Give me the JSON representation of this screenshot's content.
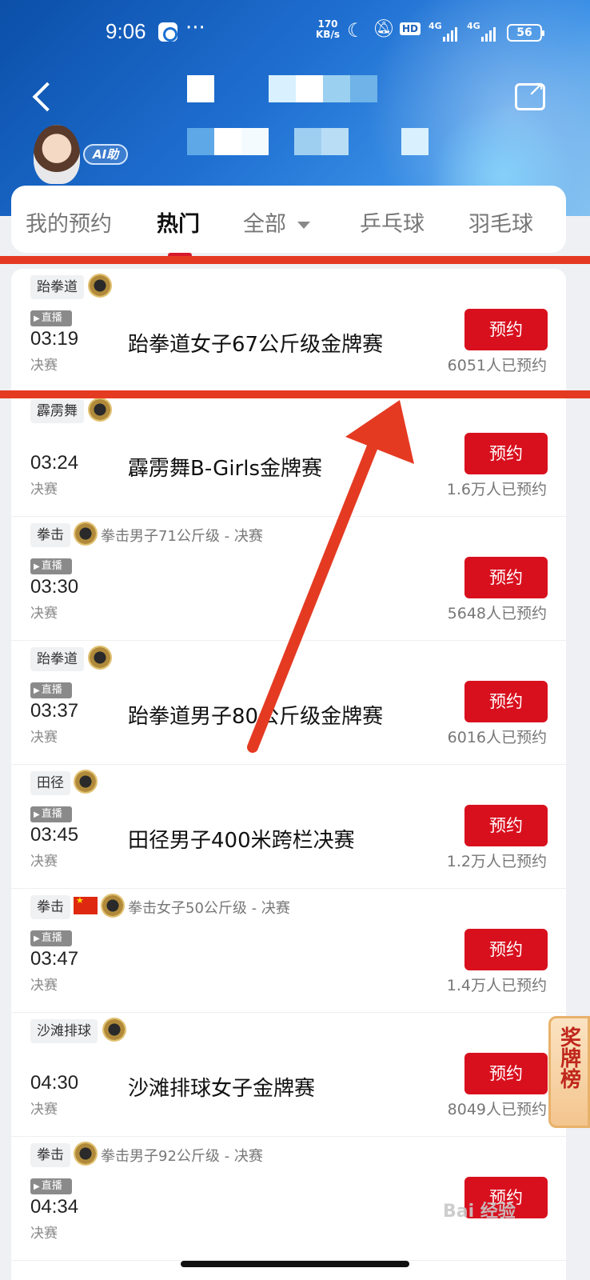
{
  "status_bar": {
    "time": "9:06",
    "speed_value": "170",
    "speed_unit": "KB/s",
    "hd": "HD",
    "net1": "4G",
    "net2": "4G",
    "battery": "56"
  },
  "header": {
    "ai_badge": "AI助"
  },
  "tabs": {
    "items": [
      "我的预约",
      "热门",
      "全部",
      "乒乓球",
      "羽毛球"
    ],
    "active": "热门"
  },
  "events": [
    {
      "tag": "跆拳道",
      "has_flag": false,
      "subtitle": "",
      "live": "直播",
      "time": "03:19",
      "stage": "决赛",
      "title": "跆拳道女子67公斤级金牌赛",
      "button": "预约",
      "count": "6051人已预约"
    },
    {
      "tag": "霹雳舞",
      "has_flag": false,
      "subtitle": "",
      "live": "",
      "time": "03:24",
      "stage": "决赛",
      "title": "霹雳舞B-Girls金牌赛",
      "button": "预约",
      "count": "1.6万人已预约"
    },
    {
      "tag": "拳击",
      "has_flag": false,
      "subtitle": "拳击男子71公斤级 - 决赛",
      "live": "直播",
      "time": "03:30",
      "stage": "决赛",
      "title": "",
      "button": "预约",
      "count": "5648人已预约"
    },
    {
      "tag": "跆拳道",
      "has_flag": false,
      "subtitle": "",
      "live": "直播",
      "time": "03:37",
      "stage": "决赛",
      "title": "跆拳道男子80公斤级金牌赛",
      "button": "预约",
      "count": "6016人已预约"
    },
    {
      "tag": "田径",
      "has_flag": false,
      "subtitle": "",
      "live": "直播",
      "time": "03:45",
      "stage": "决赛",
      "title": "田径男子400米跨栏决赛",
      "button": "预约",
      "count": "1.2万人已预约"
    },
    {
      "tag": "拳击",
      "has_flag": true,
      "subtitle": "拳击女子50公斤级 - 决赛",
      "live": "直播",
      "time": "03:47",
      "stage": "决赛",
      "title": "",
      "button": "预约",
      "count": "1.4万人已预约"
    },
    {
      "tag": "沙滩排球",
      "has_flag": false,
      "subtitle": "",
      "live": "",
      "time": "04:30",
      "stage": "决赛",
      "title": "沙滩排球女子金牌赛",
      "button": "预约",
      "count": "8049人已预约"
    },
    {
      "tag": "拳击",
      "has_flag": false,
      "subtitle": "拳击男子92公斤级 - 决赛",
      "live": "直播",
      "time": "04:34",
      "stage": "决赛",
      "title": "",
      "button": "预约",
      "count": ""
    }
  ],
  "side_widget": {
    "label": "奖牌榜"
  },
  "watermark": "Bai 经验",
  "colors": {
    "accent_red": "#d8101e",
    "header_blue": "#1f6fd1",
    "annotation_red": "#e53a22"
  },
  "icons": [
    "back-arrow-icon",
    "share-icon",
    "medal-icon",
    "china-flag-icon",
    "dropdown-icon",
    "live-play-icon"
  ]
}
